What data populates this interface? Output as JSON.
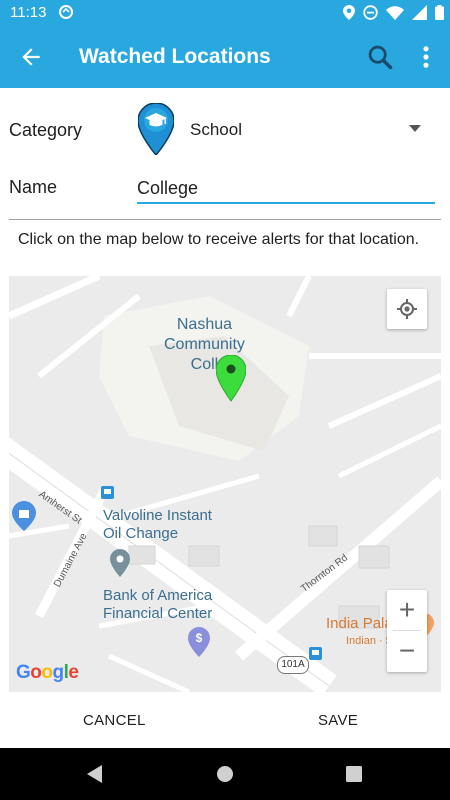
{
  "status_bar": {
    "time": "11:13",
    "icons": [
      "sync-icon",
      "location-icon",
      "do-not-disturb-icon",
      "wifi-icon",
      "signal-icon",
      "battery-icon"
    ]
  },
  "app_bar": {
    "title": "Watched Locations",
    "background_color": "#29a8e0",
    "icons": [
      "back-arrow-icon",
      "search-icon",
      "more-vert-icon"
    ]
  },
  "form": {
    "category_label": "Category",
    "category_value": "School",
    "category_icon": "graduation-cap-pin-icon",
    "name_label": "Name",
    "name_value": "College",
    "instructions": "Click on the map below to receive alerts for that location."
  },
  "map": {
    "poi": {
      "nashua": "Nashua\nCommunity\nColl",
      "valvoline": "Valvoline Instant\nOil Change",
      "boa": "Bank of America\nFinancial Center",
      "india": "India Palace",
      "india_sub": "Indian · $$"
    },
    "streets": {
      "amherst": "Amherst St",
      "dumaine": "Dumaine Ave",
      "thornton": "Thornton Rd"
    },
    "route_shield": "101A",
    "logo": "Google",
    "zoom_in": "+",
    "zoom_out": "−",
    "marker_color": "#3ddc3d"
  },
  "actions": {
    "cancel": "CANCEL",
    "save": "SAVE"
  },
  "nav_bar": {
    "icons": [
      "nav-back-icon",
      "nav-home-icon",
      "nav-recents-icon"
    ]
  }
}
